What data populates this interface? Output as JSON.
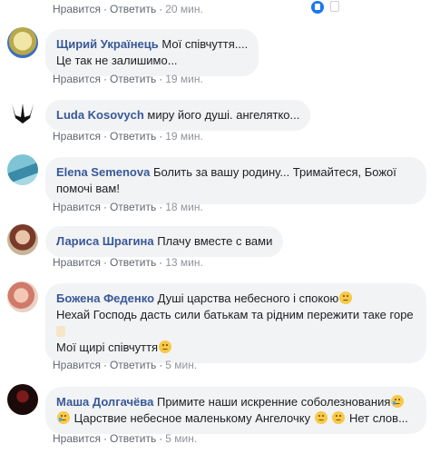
{
  "labels": {
    "like": "Нравится",
    "reply": "Ответить",
    "sep": "·"
  },
  "comments": [
    {
      "author": "",
      "text": [],
      "time": "20 мин."
    },
    {
      "author": "Щирий Українець",
      "text": [
        "Мої співчуття....",
        "Це так не залишимо..."
      ],
      "time": "19 мин."
    },
    {
      "author": "Luda Kosovych",
      "text": [
        "миру його душі. ангелятко..."
      ],
      "time": "19 мин."
    },
    {
      "author": "Elena Semenova",
      "text": [
        "Болить за вашу родину... Тримайтеся, Божої",
        "помочі вам!"
      ],
      "time": "18 мин."
    },
    {
      "author": "Лариса Шрагина",
      "text": [
        "Плачу вместе с вами"
      ],
      "time": "13 мин."
    },
    {
      "author": "Божена Феденко",
      "text": [
        "Душі царства небесного і спокою",
        "Нехай Господь дасть сили батькам та рідним пережити таке горе",
        "Мої щирі співчуття"
      ],
      "time": "5 мин."
    },
    {
      "author": "Маша Долгачёва",
      "text": [
        "Примите наши искренние соболезнования",
        "Царствие небесное маленькому Ангелочку",
        "Нет слов..."
      ],
      "time": "5 мин."
    }
  ],
  "colors": {
    "author": "#385898",
    "bubble": "#f2f3f5",
    "meta": "#606770"
  }
}
